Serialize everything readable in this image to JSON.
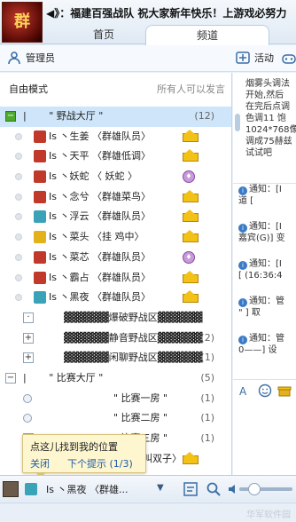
{
  "header": {
    "logo_text": "群",
    "marquee": "◀》：福建百强战队 祝大家新年快乐！上游戏必努力",
    "tabs": [
      {
        "label": "首页"
      },
      {
        "label": "频道"
      }
    ]
  },
  "toolbar": {
    "admin_label": "管理员",
    "activity_label": "活动"
  },
  "mode": {
    "label": "自由模式",
    "hint": "所有人可以发言"
  },
  "channel_root": {
    "name": "| 　　\" 野战大厅 \"",
    "count": "(12)"
  },
  "members": [
    {
      "name": "Is  丶生姜  〈群雄队员〉",
      "role": "crown",
      "gift_color": "#c0392b"
    },
    {
      "name": "Is  丶天平  〈群雄低调〉",
      "role": "crown",
      "gift_color": "#c0392b"
    },
    {
      "name": "Is  丶妖蛇  〈  妖蛇  〉",
      "role": "badge",
      "gift_color": "#c0392b"
    },
    {
      "name": "Is  丶念兮  〈群雄菜鸟〉",
      "role": "crown",
      "gift_color": "#c0392b"
    },
    {
      "name": "Is  丶浮云  〈群雄队员〉",
      "role": "crown",
      "gift_color": "#3aa3b7"
    },
    {
      "name": "Is  丶菜头  〈挂  鸡中〉",
      "role": "crown",
      "gift_color": "#e3b21a"
    },
    {
      "name": "Is  丶菜芯  〈群雄队员〉",
      "role": "badge",
      "gift_color": "#c0392b"
    },
    {
      "name": "Is  丶霸占  〈群雄队员〉",
      "role": "crown",
      "gift_color": "#c0392b"
    },
    {
      "name": "Is  丶黑夜  〈群雄队员〉",
      "role": "crown",
      "gift_color": "#3aa3b7"
    }
  ],
  "subchannels": [
    {
      "name": "▓▓▓▓▓▓爆破野战区▓▓▓▓▓▓",
      "count": ""
    },
    {
      "name": "▓▓▓▓▓▓静音野战区▓▓▓▓▓▓",
      "count": "(2)"
    },
    {
      "name": "▓▓▓▓▓▓闲聊野战区▓▓▓▓▓▓",
      "count": "(1)"
    }
  ],
  "match_hall": {
    "name": "| 　　\" 比赛大厅 \"",
    "count": "(5)"
  },
  "rooms": [
    {
      "name": "\" 比赛一房 \"",
      "count": "(1)"
    },
    {
      "name": "\" 比赛二房 \"",
      "count": "(1)"
    },
    {
      "name": "\" 比赛三房 \"",
      "count": "(1)"
    }
  ],
  "partial_row": "号叫双子〉",
  "popup": {
    "text": "点这儿找到我的位置",
    "close": "关闭",
    "next": "下个提示 (1/3)"
  },
  "announcement": {
    "lines": [
      "烟雾头调法",
      "开始,然后",
      "在完后点调",
      "色调11 饱",
      "1024*768像",
      "调成75赫兹",
      "试试吧"
    ]
  },
  "notices": [
    {
      "line1": "通知：[I",
      "line2": "道 ["
    },
    {
      "line1": "通知：[I",
      "line2": "嘉宾(G)] 变"
    },
    {
      "line1": "通知：[I",
      "line2": "[      (16:36:4"
    },
    {
      "line1": "通知：管",
      "line2": "\"    ] 取"
    },
    {
      "line1": "通知：管",
      "line2": "0——] 设"
    }
  ],
  "bottom": {
    "user": "Is  丶黑夜  〈群雄..."
  },
  "watermark": "华军软件园"
}
